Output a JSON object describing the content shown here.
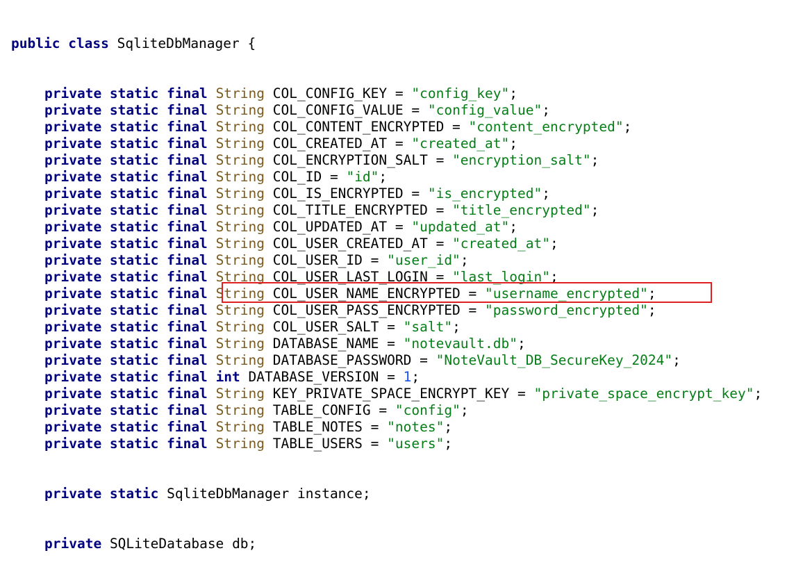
{
  "code": {
    "class_decl": {
      "kw1": "public",
      "kw2": "class",
      "name": "SqliteDbManager",
      "brace": "{"
    },
    "modifiers": "private static final",
    "fields": [
      {
        "type": "String",
        "name": "COL_CONFIG_KEY",
        "value": "\"config_key\""
      },
      {
        "type": "String",
        "name": "COL_CONFIG_VALUE",
        "value": "\"config_value\""
      },
      {
        "type": "String",
        "name": "COL_CONTENT_ENCRYPTED",
        "value": "\"content_encrypted\""
      },
      {
        "type": "String",
        "name": "COL_CREATED_AT",
        "value": "\"created_at\""
      },
      {
        "type": "String",
        "name": "COL_ENCRYPTION_SALT",
        "value": "\"encryption_salt\""
      },
      {
        "type": "String",
        "name": "COL_ID",
        "value": "\"id\""
      },
      {
        "type": "String",
        "name": "COL_IS_ENCRYPTED",
        "value": "\"is_encrypted\""
      },
      {
        "type": "String",
        "name": "COL_TITLE_ENCRYPTED",
        "value": "\"title_encrypted\""
      },
      {
        "type": "String",
        "name": "COL_UPDATED_AT",
        "value": "\"updated_at\""
      },
      {
        "type": "String",
        "name": "COL_USER_CREATED_AT",
        "value": "\"created_at\""
      },
      {
        "type": "String",
        "name": "COL_USER_ID",
        "value": "\"user_id\""
      },
      {
        "type": "String",
        "name": "COL_USER_LAST_LOGIN",
        "value": "\"last_login\""
      },
      {
        "type": "String",
        "name": "COL_USER_NAME_ENCRYPTED",
        "value": "\"username_encrypted\""
      },
      {
        "type": "String",
        "name": "COL_USER_PASS_ENCRYPTED",
        "value": "\"password_encrypted\""
      },
      {
        "type": "String",
        "name": "COL_USER_SALT",
        "value": "\"salt\""
      },
      {
        "type": "String",
        "name": "DATABASE_NAME",
        "value": "\"notevault.db\""
      },
      {
        "type": "String",
        "name": "DATABASE_PASSWORD",
        "value": "\"NoteVault_DB_SecureKey_2024\"",
        "highlighted": true
      },
      {
        "type": "int",
        "name": "DATABASE_VERSION",
        "value": "1"
      },
      {
        "type": "String",
        "name": "KEY_PRIVATE_SPACE_ENCRYPT_KEY",
        "value": "\"private_space_encrypt_key\""
      },
      {
        "type": "String",
        "name": "TABLE_CONFIG",
        "value": "\"config\""
      },
      {
        "type": "String",
        "name": "TABLE_NOTES",
        "value": "\"notes\""
      },
      {
        "type": "String",
        "name": "TABLE_USERS",
        "value": "\"users\""
      }
    ],
    "instance_field": {
      "modifiers": "private static",
      "type": "SqliteDbManager",
      "name": "instance"
    },
    "db_field": {
      "modifiers": "private",
      "type": "SQLiteDatabase",
      "name": "db"
    },
    "equals": " = ",
    "semicolon": ";"
  },
  "colors": {
    "keyword": "#000080",
    "type": "#7a5a1f",
    "string": "#067d17",
    "number": "#1750eb",
    "highlight_box": "#e02020"
  }
}
